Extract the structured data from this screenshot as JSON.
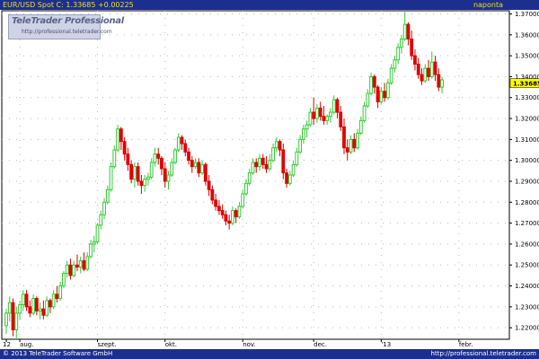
{
  "header": {
    "title": "EUR/USD Spot C: 1.33685 +0.00225",
    "period": "naponta"
  },
  "logo": {
    "title": "TeleTrader Professional",
    "url": "http://professional.teletrader.com"
  },
  "footer": {
    "copyright": "© 2013 TeleTrader Software GmbH",
    "url": "http://professional.teletrader.com"
  },
  "colors": {
    "up": "#33cc33",
    "down": "#e00000",
    "bar": "#1c2f8f",
    "text": "#f2e000",
    "grid": "#bbbbbb",
    "last_bg": "#ffff00"
  },
  "chart_data": {
    "type": "candlestick",
    "title": "EUR/USD Spot C: 1.33685 +0.00225",
    "xlabel": "",
    "ylabel": "",
    "ylim": [
      1.2145,
      1.3715
    ],
    "last_value": 1.33685,
    "last_label": "1.33685",
    "y_ticks": [
      1.22,
      1.23,
      1.24,
      1.25,
      1.26,
      1.27,
      1.28,
      1.29,
      1.3,
      1.31,
      1.32,
      1.33,
      1.34,
      1.35,
      1.36,
      1.37
    ],
    "y_tick_labels": [
      "1.22000",
      "1.23000",
      "1.24000",
      "1.25000",
      "1.26000",
      "1.27000",
      "1.28000",
      "1.29000",
      "1.30000",
      "1.31000",
      "1.32000",
      "1.33000",
      "1.34000",
      "1.35000",
      "1.36000",
      "1.37000"
    ],
    "x_ticks": [
      {
        "label": "12",
        "index": 0
      },
      {
        "label": "aug.",
        "index": 4
      },
      {
        "label": "szept.",
        "index": 27
      },
      {
        "label": "okt.",
        "index": 47
      },
      {
        "label": "nov.",
        "index": 70
      },
      {
        "label": "dec.",
        "index": 91
      },
      {
        "label": "'13",
        "index": 111
      },
      {
        "label": "febr.",
        "index": 134
      }
    ],
    "grid": true,
    "series": [
      {
        "candles": [
          [
            1.221,
            1.229,
            1.217,
            1.227
          ],
          [
            1.227,
            1.235,
            1.223,
            1.232
          ],
          [
            1.232,
            1.234,
            1.216,
            1.219
          ],
          [
            1.219,
            1.23,
            1.215,
            1.227
          ],
          [
            1.227,
            1.233,
            1.224,
            1.231
          ],
          [
            1.231,
            1.238,
            1.228,
            1.236
          ],
          [
            1.236,
            1.238,
            1.228,
            1.23
          ],
          [
            1.23,
            1.233,
            1.225,
            1.227
          ],
          [
            1.227,
            1.236,
            1.226,
            1.234
          ],
          [
            1.234,
            1.235,
            1.226,
            1.228
          ],
          [
            1.228,
            1.232,
            1.224,
            1.229
          ],
          [
            1.229,
            1.233,
            1.224,
            1.226
          ],
          [
            1.226,
            1.235,
            1.225,
            1.233
          ],
          [
            1.233,
            1.234,
            1.227,
            1.23
          ],
          [
            1.23,
            1.238,
            1.229,
            1.236
          ],
          [
            1.236,
            1.24,
            1.232,
            1.234
          ],
          [
            1.234,
            1.242,
            1.233,
            1.24
          ],
          [
            1.24,
            1.247,
            1.239,
            1.246
          ],
          [
            1.246,
            1.252,
            1.244,
            1.25
          ],
          [
            1.25,
            1.253,
            1.243,
            1.245
          ],
          [
            1.245,
            1.252,
            1.244,
            1.25
          ],
          [
            1.25,
            1.255,
            1.247,
            1.249
          ],
          [
            1.249,
            1.254,
            1.246,
            1.252
          ],
          [
            1.252,
            1.256,
            1.247,
            1.248
          ],
          [
            1.248,
            1.256,
            1.247,
            1.254
          ],
          [
            1.254,
            1.262,
            1.253,
            1.26
          ],
          [
            1.26,
            1.264,
            1.256,
            1.261
          ],
          [
            1.261,
            1.27,
            1.26,
            1.269
          ],
          [
            1.269,
            1.276,
            1.267,
            1.274
          ],
          [
            1.274,
            1.282,
            1.272,
            1.28
          ],
          [
            1.28,
            1.288,
            1.279,
            1.286
          ],
          [
            1.286,
            1.299,
            1.285,
            1.297
          ],
          [
            1.297,
            1.307,
            1.296,
            1.305
          ],
          [
            1.305,
            1.317,
            1.304,
            1.315
          ],
          [
            1.315,
            1.316,
            1.305,
            1.309
          ],
          [
            1.309,
            1.311,
            1.3,
            1.303
          ],
          [
            1.303,
            1.306,
            1.295,
            1.298
          ],
          [
            1.298,
            1.3,
            1.289,
            1.291
          ],
          [
            1.291,
            1.299,
            1.287,
            1.297
          ],
          [
            1.297,
            1.299,
            1.288,
            1.29
          ],
          [
            1.29,
            1.293,
            1.284,
            1.288
          ],
          [
            1.288,
            1.293,
            1.285,
            1.291
          ],
          [
            1.291,
            1.294,
            1.288,
            1.292
          ],
          [
            1.292,
            1.301,
            1.291,
            1.299
          ],
          [
            1.299,
            1.306,
            1.297,
            1.303
          ],
          [
            1.303,
            1.306,
            1.298,
            1.301
          ],
          [
            1.301,
            1.302,
            1.293,
            1.296
          ],
          [
            1.296,
            1.299,
            1.287,
            1.29
          ],
          [
            1.29,
            1.295,
            1.286,
            1.293
          ],
          [
            1.293,
            1.301,
            1.292,
            1.299
          ],
          [
            1.299,
            1.306,
            1.298,
            1.305
          ],
          [
            1.305,
            1.313,
            1.304,
            1.311
          ],
          [
            1.311,
            1.312,
            1.305,
            1.308
          ],
          [
            1.308,
            1.31,
            1.302,
            1.304
          ],
          [
            1.304,
            1.306,
            1.298,
            1.3
          ],
          [
            1.3,
            1.302,
            1.294,
            1.297
          ],
          [
            1.297,
            1.301,
            1.296,
            1.299
          ],
          [
            1.299,
            1.301,
            1.292,
            1.294
          ],
          [
            1.294,
            1.3,
            1.293,
            1.298
          ],
          [
            1.298,
            1.299,
            1.288,
            1.29
          ],
          [
            1.29,
            1.293,
            1.283,
            1.286
          ],
          [
            1.286,
            1.288,
            1.279,
            1.281
          ],
          [
            1.281,
            1.284,
            1.276,
            1.278
          ],
          [
            1.278,
            1.281,
            1.274,
            1.276
          ],
          [
            1.276,
            1.279,
            1.272,
            1.274
          ],
          [
            1.274,
            1.276,
            1.269,
            1.271
          ],
          [
            1.271,
            1.274,
            1.267,
            1.27
          ],
          [
            1.27,
            1.278,
            1.269,
            1.276
          ],
          [
            1.276,
            1.277,
            1.27,
            1.273
          ],
          [
            1.273,
            1.28,
            1.272,
            1.278
          ],
          [
            1.278,
            1.286,
            1.277,
            1.284
          ],
          [
            1.284,
            1.291,
            1.283,
            1.289
          ],
          [
            1.289,
            1.296,
            1.288,
            1.294
          ],
          [
            1.294,
            1.301,
            1.293,
            1.299
          ],
          [
            1.299,
            1.301,
            1.294,
            1.297
          ],
          [
            1.297,
            1.303,
            1.295,
            1.301
          ],
          [
            1.301,
            1.303,
            1.296,
            1.298
          ],
          [
            1.298,
            1.302,
            1.294,
            1.296
          ],
          [
            1.296,
            1.303,
            1.295,
            1.3
          ],
          [
            1.3,
            1.308,
            1.299,
            1.306
          ],
          [
            1.306,
            1.311,
            1.304,
            1.309
          ],
          [
            1.309,
            1.31,
            1.302,
            1.305
          ],
          [
            1.305,
            1.308,
            1.291,
            1.294
          ],
          [
            1.294,
            1.296,
            1.287,
            1.289
          ],
          [
            1.289,
            1.295,
            1.288,
            1.293
          ],
          [
            1.293,
            1.3,
            1.292,
            1.298
          ],
          [
            1.298,
            1.306,
            1.297,
            1.304
          ],
          [
            1.304,
            1.312,
            1.303,
            1.31
          ],
          [
            1.31,
            1.317,
            1.308,
            1.315
          ],
          [
            1.315,
            1.319,
            1.311,
            1.317
          ],
          [
            1.317,
            1.325,
            1.316,
            1.323
          ],
          [
            1.323,
            1.33,
            1.317,
            1.32
          ],
          [
            1.32,
            1.327,
            1.318,
            1.325
          ],
          [
            1.325,
            1.328,
            1.319,
            1.321
          ],
          [
            1.321,
            1.326,
            1.317,
            1.319
          ],
          [
            1.319,
            1.322,
            1.317,
            1.321
          ],
          [
            1.321,
            1.325,
            1.318,
            1.323
          ],
          [
            1.323,
            1.331,
            1.322,
            1.329
          ],
          [
            1.329,
            1.33,
            1.32,
            1.323
          ],
          [
            1.323,
            1.326,
            1.314,
            1.316
          ],
          [
            1.316,
            1.32,
            1.303,
            1.306
          ],
          [
            1.306,
            1.31,
            1.3,
            1.304
          ],
          [
            1.304,
            1.312,
            1.303,
            1.31
          ],
          [
            1.31,
            1.313,
            1.304,
            1.306
          ],
          [
            1.306,
            1.315,
            1.305,
            1.313
          ],
          [
            1.313,
            1.321,
            1.312,
            1.319
          ],
          [
            1.319,
            1.328,
            1.318,
            1.326
          ],
          [
            1.326,
            1.334,
            1.325,
            1.332
          ],
          [
            1.332,
            1.342,
            1.331,
            1.34
          ],
          [
            1.34,
            1.341,
            1.332,
            1.335
          ],
          [
            1.335,
            1.336,
            1.325,
            1.328
          ],
          [
            1.328,
            1.335,
            1.327,
            1.333
          ],
          [
            1.333,
            1.337,
            1.328,
            1.33
          ],
          [
            1.33,
            1.339,
            1.329,
            1.337
          ],
          [
            1.337,
            1.346,
            1.336,
            1.344
          ],
          [
            1.344,
            1.35,
            1.342,
            1.348
          ],
          [
            1.348,
            1.356,
            1.346,
            1.354
          ],
          [
            1.354,
            1.36,
            1.351,
            1.358
          ],
          [
            1.358,
            1.371,
            1.357,
            1.365
          ],
          [
            1.365,
            1.366,
            1.355,
            1.358
          ],
          [
            1.358,
            1.362,
            1.348,
            1.35
          ],
          [
            1.35,
            1.353,
            1.343,
            1.346
          ],
          [
            1.346,
            1.349,
            1.339,
            1.341
          ],
          [
            1.341,
            1.344,
            1.336,
            1.338
          ],
          [
            1.338,
            1.346,
            1.337,
            1.344
          ],
          [
            1.344,
            1.348,
            1.338,
            1.34
          ],
          [
            1.34,
            1.352,
            1.339,
            1.347
          ],
          [
            1.347,
            1.35,
            1.338,
            1.341
          ],
          [
            1.341,
            1.344,
            1.333,
            1.335
          ],
          [
            1.335,
            1.34,
            1.332,
            1.3385
          ]
        ]
      }
    ]
  }
}
